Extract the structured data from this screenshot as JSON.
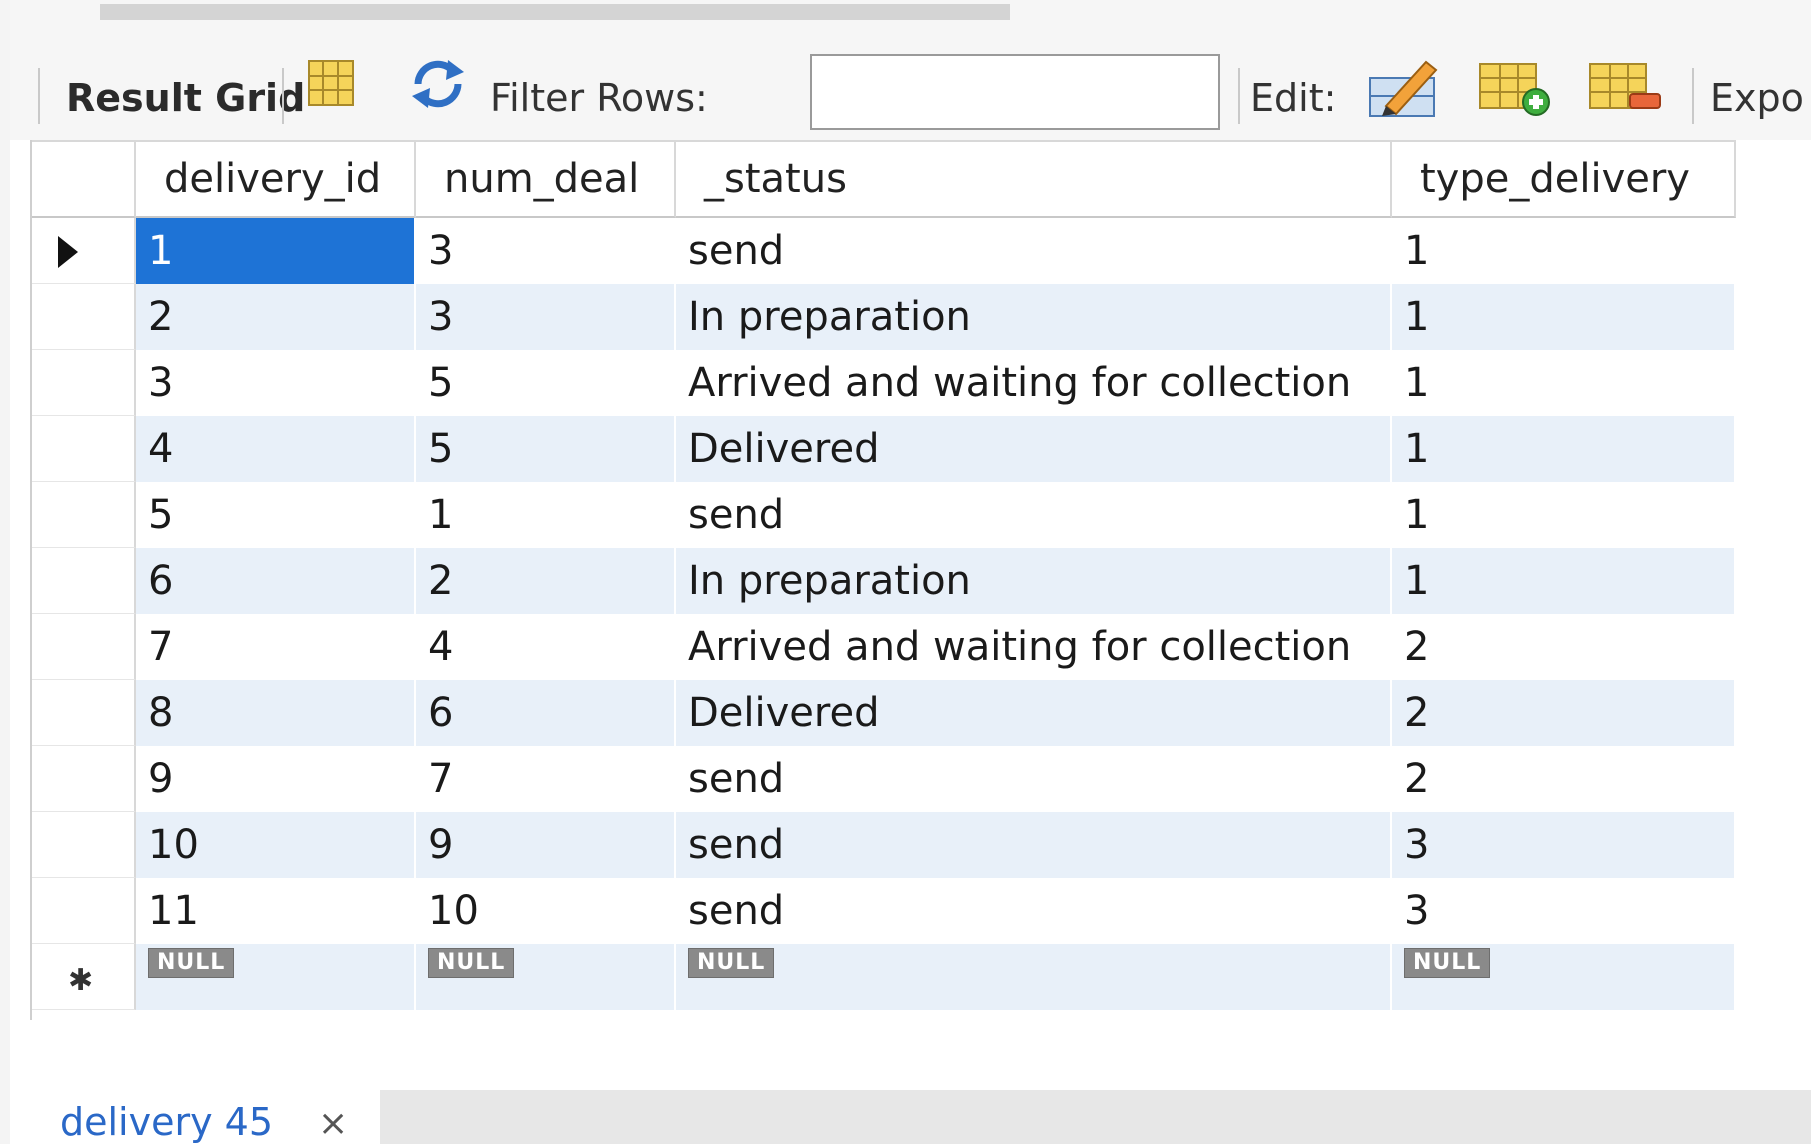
{
  "toolbar": {
    "result_grid_label": "Result Grid",
    "filter_rows_label": "Filter Rows:",
    "filter_value": "",
    "edit_label": "Edit:",
    "export_label": "Expo"
  },
  "grid": {
    "columns": [
      "delivery_id",
      "num_deal",
      "_status",
      "type_delivery"
    ],
    "rows": [
      [
        "1",
        "3",
        "send",
        "1"
      ],
      [
        "2",
        "3",
        "In preparation",
        "1"
      ],
      [
        "3",
        "5",
        "Arrived and waiting for collection",
        "1"
      ],
      [
        "4",
        "5",
        "Delivered",
        "1"
      ],
      [
        "5",
        "1",
        "send",
        "1"
      ],
      [
        "6",
        "2",
        "In preparation",
        "1"
      ],
      [
        "7",
        "4",
        "Arrived and waiting for collection",
        "2"
      ],
      [
        "8",
        "6",
        "Delivered",
        "2"
      ],
      [
        "9",
        "7",
        "send",
        "2"
      ],
      [
        "10",
        "9",
        "send",
        "3"
      ],
      [
        "11",
        "10",
        "send",
        "3"
      ]
    ],
    "null_label": "NULL"
  },
  "tab": {
    "label": "delivery 45",
    "close_glyph": "×"
  },
  "colors": {
    "selection": "#1e73d6",
    "alt_row": "#e8f0f9",
    "tab_text": "#2a68c7"
  }
}
